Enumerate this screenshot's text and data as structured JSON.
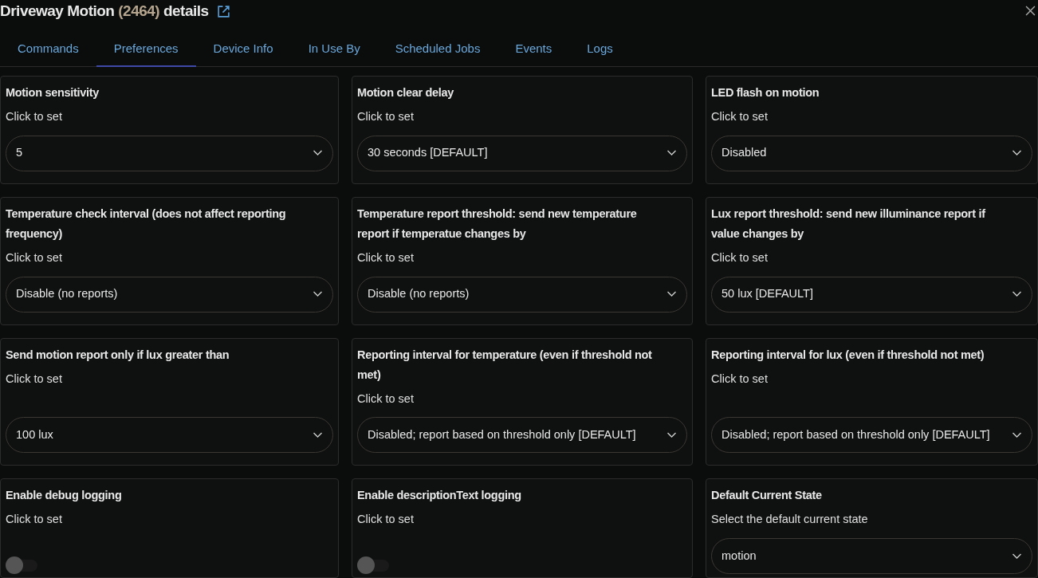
{
  "header": {
    "title": "Driveway Motion",
    "device_id": "(2464)",
    "suffix": "details"
  },
  "tabs": [
    {
      "label": "Commands",
      "selected": false
    },
    {
      "label": "Preferences",
      "selected": true
    },
    {
      "label": "Device Info",
      "selected": false
    },
    {
      "label": "In Use By",
      "selected": false
    },
    {
      "label": "Scheduled Jobs",
      "selected": false
    },
    {
      "label": "Events",
      "selected": false
    },
    {
      "label": "Logs",
      "selected": false
    }
  ],
  "preferences": [
    {
      "kind": "select",
      "title": "Motion sensitivity",
      "hint": "Click to set",
      "value": "5"
    },
    {
      "kind": "select",
      "title": "Motion clear delay",
      "hint": "Click to set",
      "value": "30 seconds [DEFAULT]"
    },
    {
      "kind": "select",
      "title": "LED flash on motion",
      "hint": "Click to set",
      "value": "Disabled"
    },
    {
      "kind": "select",
      "title": "Temperature check interval (does not affect reporting frequency)",
      "hint": "Click to set",
      "value": "Disable (no reports)"
    },
    {
      "kind": "select",
      "title": "Temperature report threshold: send new temperature report if temperatue changes by",
      "hint": "Click to set",
      "value": "Disable (no reports)"
    },
    {
      "kind": "select",
      "title": "Lux report threshold: send new illuminance report if value changes by",
      "hint": "Click to set",
      "value": "50 lux [DEFAULT]"
    },
    {
      "kind": "select",
      "title": "Send motion report only if lux greater than",
      "hint": "Click to set",
      "value": "100 lux"
    },
    {
      "kind": "select",
      "title": "Reporting interval for temperature (even if threshold not met)",
      "hint": "Click to set",
      "value": "Disabled; report based on threshold only [DEFAULT]"
    },
    {
      "kind": "select",
      "title": "Reporting interval for lux (even if threshold not met)",
      "hint": "Click to set",
      "value": "Disabled; report based on threshold only [DEFAULT]"
    },
    {
      "kind": "toggle",
      "title": "Enable debug logging",
      "hint": "Click to set",
      "on": false
    },
    {
      "kind": "toggle",
      "title": "Enable descriptionText logging",
      "hint": "Click to set",
      "on": false
    },
    {
      "kind": "select",
      "title": "Default Current State",
      "hint": "Select the default current state",
      "value": "motion"
    }
  ]
}
